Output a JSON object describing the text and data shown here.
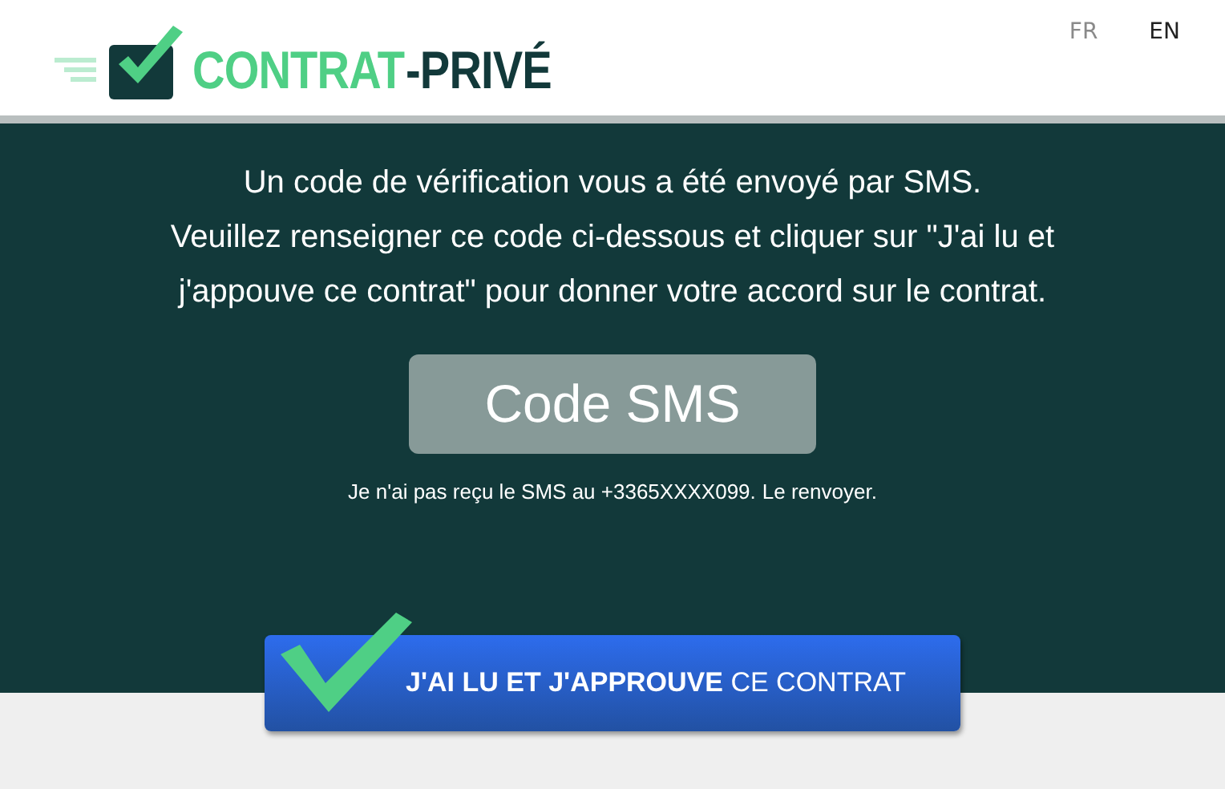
{
  "logo": {
    "part_1": "CONTRAT",
    "part_2": "-PRIVÉ"
  },
  "languages": [
    {
      "label": "FR",
      "selected": false
    },
    {
      "label": "EN",
      "selected": true
    }
  ],
  "message_lines": [
    "Un code de vérification vous a été envoyé par SMS.",
    "Veuillez renseigner ce code ci-dessous et cliquer sur \"J'ai lu et",
    "j'appouve ce contrat\" pour donner votre accord sur le contrat."
  ],
  "code_field": {
    "placeholder": "Code SMS"
  },
  "resend": {
    "text": "Je n'ai pas reçu le SMS au +3365XXXX099.",
    "link": "Le renvoyer."
  },
  "approve_button": "**J'AI LU ET J'APPROUVE** CE CONTRAT"
}
